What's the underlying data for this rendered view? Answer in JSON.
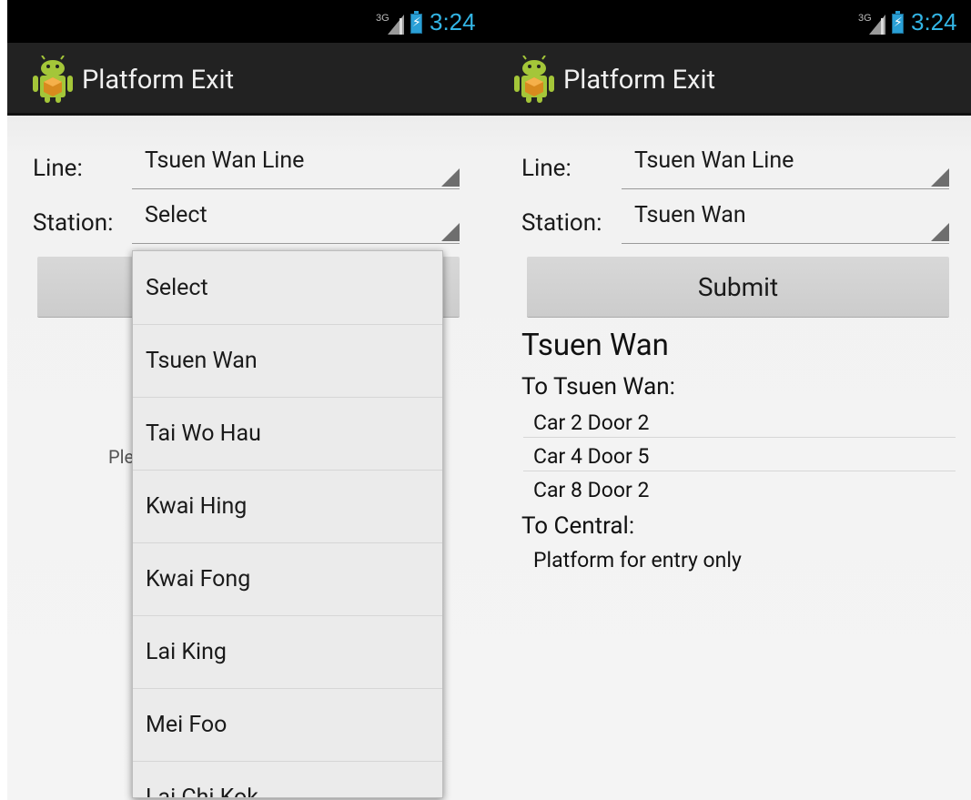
{
  "status_bar": {
    "network": "3G",
    "time": "3:24"
  },
  "app": {
    "title": "Platform Exit"
  },
  "form": {
    "line_label": "Line:",
    "station_label": "Station:",
    "line_value": "Tsuen Wan Line",
    "submit_label": "Submit"
  },
  "left_screen": {
    "station_value": "Select",
    "partial_hint": "Ple",
    "dropdown_options": [
      "Select",
      "Tsuen Wan",
      "Tai Wo Hau",
      "Kwai Hing",
      "Kwai Fong",
      "Lai King",
      "Mei Foo",
      "Lai Chi Kok"
    ]
  },
  "right_screen": {
    "station_value": "Tsuen Wan",
    "result": {
      "station": "Tsuen Wan",
      "directions": [
        {
          "heading": "To Tsuen Wan:",
          "entries": [
            "Car 2 Door 2",
            "Car 4 Door 5",
            "Car 8 Door 2"
          ]
        },
        {
          "heading": "To Central:",
          "entries": [
            "Platform for entry only"
          ]
        }
      ]
    }
  }
}
